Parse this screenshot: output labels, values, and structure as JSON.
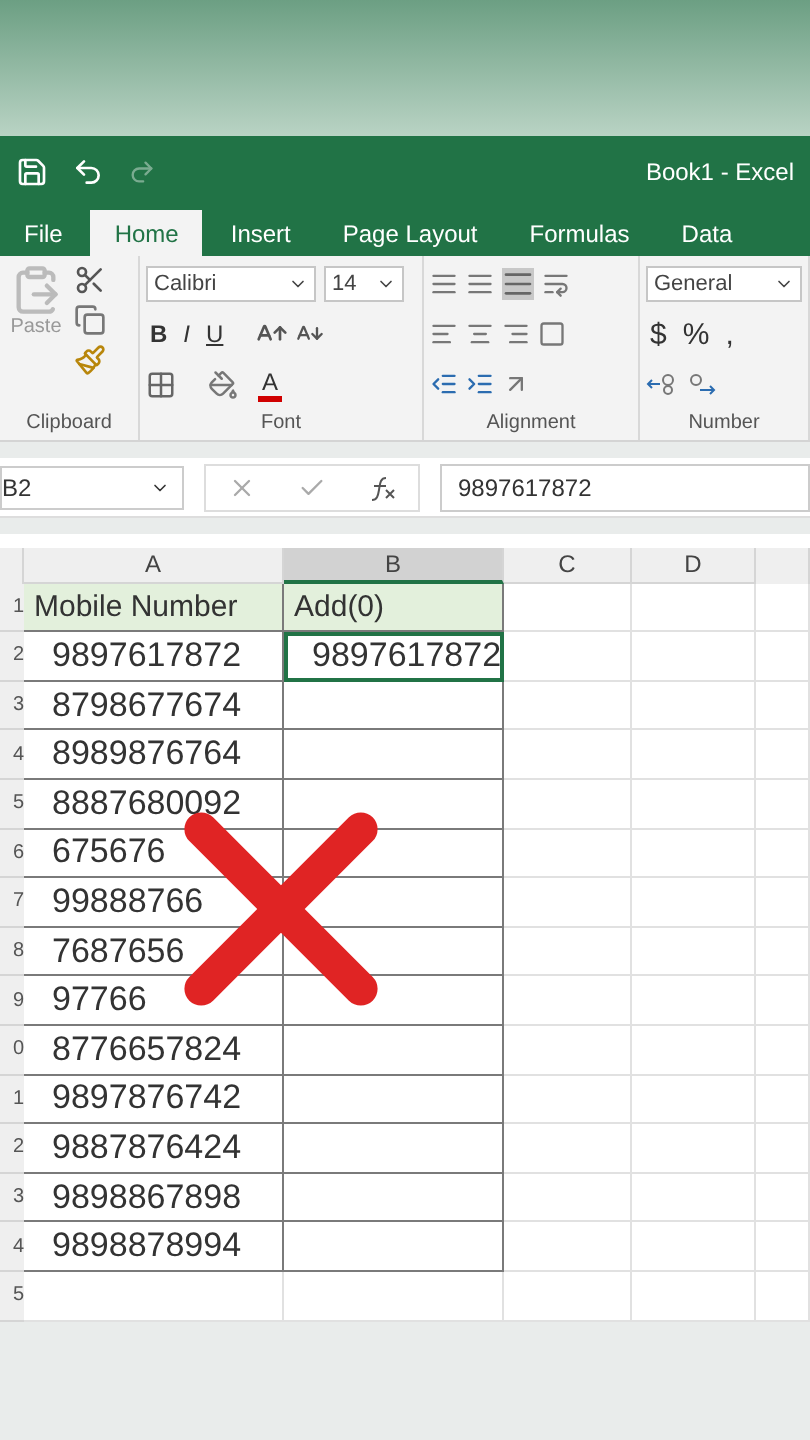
{
  "title_bar": {
    "title": "Book1 - Excel"
  },
  "ribbon_tabs": [
    {
      "label": "File",
      "selected": false
    },
    {
      "label": "Home",
      "selected": true
    },
    {
      "label": "Insert",
      "selected": false
    },
    {
      "label": "Page Layout",
      "selected": false
    },
    {
      "label": "Formulas",
      "selected": false
    },
    {
      "label": "Data",
      "selected": false
    }
  ],
  "ribbon": {
    "paste_label": "Paste",
    "font_name": "Calibri",
    "font_size": "14",
    "bold": "B",
    "italic": "I",
    "underline": "U",
    "font_color": "A",
    "number_format": "General",
    "currency": "$",
    "percent": "%",
    "comma": ",",
    "groups": [
      "Clipboard",
      "Font",
      "Alignment",
      "Number"
    ]
  },
  "formula_bar": {
    "name_box": "B2",
    "value": "9897617872"
  },
  "columns": [
    {
      "label": "A",
      "selected": false
    },
    {
      "label": "B",
      "selected": true
    },
    {
      "label": "C",
      "selected": false
    },
    {
      "label": "D",
      "selected": false
    }
  ],
  "rows": [
    {
      "number": "1",
      "kind": "header",
      "cells": [
        {
          "text": "Mobile Number",
          "selected": false
        },
        {
          "text": "Add(0)",
          "selected": false
        }
      ]
    },
    {
      "number": "2",
      "kind": "data",
      "cells": [
        {
          "text": "9897617872",
          "selected": false
        },
        {
          "text": "9897617872",
          "selected": true
        }
      ]
    },
    {
      "number": "3",
      "kind": "data",
      "cells": [
        {
          "text": "8798677674",
          "selected": false
        },
        {
          "text": "",
          "selected": false
        }
      ]
    },
    {
      "number": "4",
      "kind": "data",
      "cells": [
        {
          "text": "8989876764",
          "selected": false
        },
        {
          "text": "",
          "selected": false
        }
      ]
    },
    {
      "number": "5",
      "kind": "data",
      "cells": [
        {
          "text": "8887680092",
          "selected": false
        },
        {
          "text": "",
          "selected": false
        }
      ]
    },
    {
      "number": "6",
      "kind": "data",
      "cells": [
        {
          "text": "675676",
          "selected": false
        },
        {
          "text": "",
          "selected": false
        }
      ]
    },
    {
      "number": "7",
      "kind": "data",
      "cells": [
        {
          "text": "99888766",
          "selected": false
        },
        {
          "text": "",
          "selected": false
        }
      ]
    },
    {
      "number": "8",
      "kind": "data",
      "cells": [
        {
          "text": "7687656",
          "selected": false
        },
        {
          "text": "",
          "selected": false
        }
      ]
    },
    {
      "number": "9",
      "kind": "data",
      "cells": [
        {
          "text": "97766",
          "selected": false
        },
        {
          "text": "",
          "selected": false
        }
      ]
    },
    {
      "number": "0",
      "kind": "data",
      "cells": [
        {
          "text": "8776657824",
          "selected": false
        },
        {
          "text": "",
          "selected": false
        }
      ]
    },
    {
      "number": "1",
      "kind": "data",
      "cells": [
        {
          "text": "9897876742",
          "selected": false
        },
        {
          "text": "",
          "selected": false
        }
      ]
    },
    {
      "number": "2",
      "kind": "data",
      "cells": [
        {
          "text": "9887876424",
          "selected": false
        },
        {
          "text": "",
          "selected": false
        }
      ]
    },
    {
      "number": "3",
      "kind": "data",
      "cells": [
        {
          "text": "9898867898",
          "selected": false
        },
        {
          "text": "",
          "selected": false
        }
      ]
    },
    {
      "number": "4",
      "kind": "data",
      "cells": [
        {
          "text": "9898878994",
          "selected": false
        },
        {
          "text": "",
          "selected": false
        }
      ]
    },
    {
      "number": "5",
      "kind": "empty",
      "cells": [
        {
          "text": "",
          "selected": false
        },
        {
          "text": "",
          "selected": false
        }
      ]
    }
  ]
}
